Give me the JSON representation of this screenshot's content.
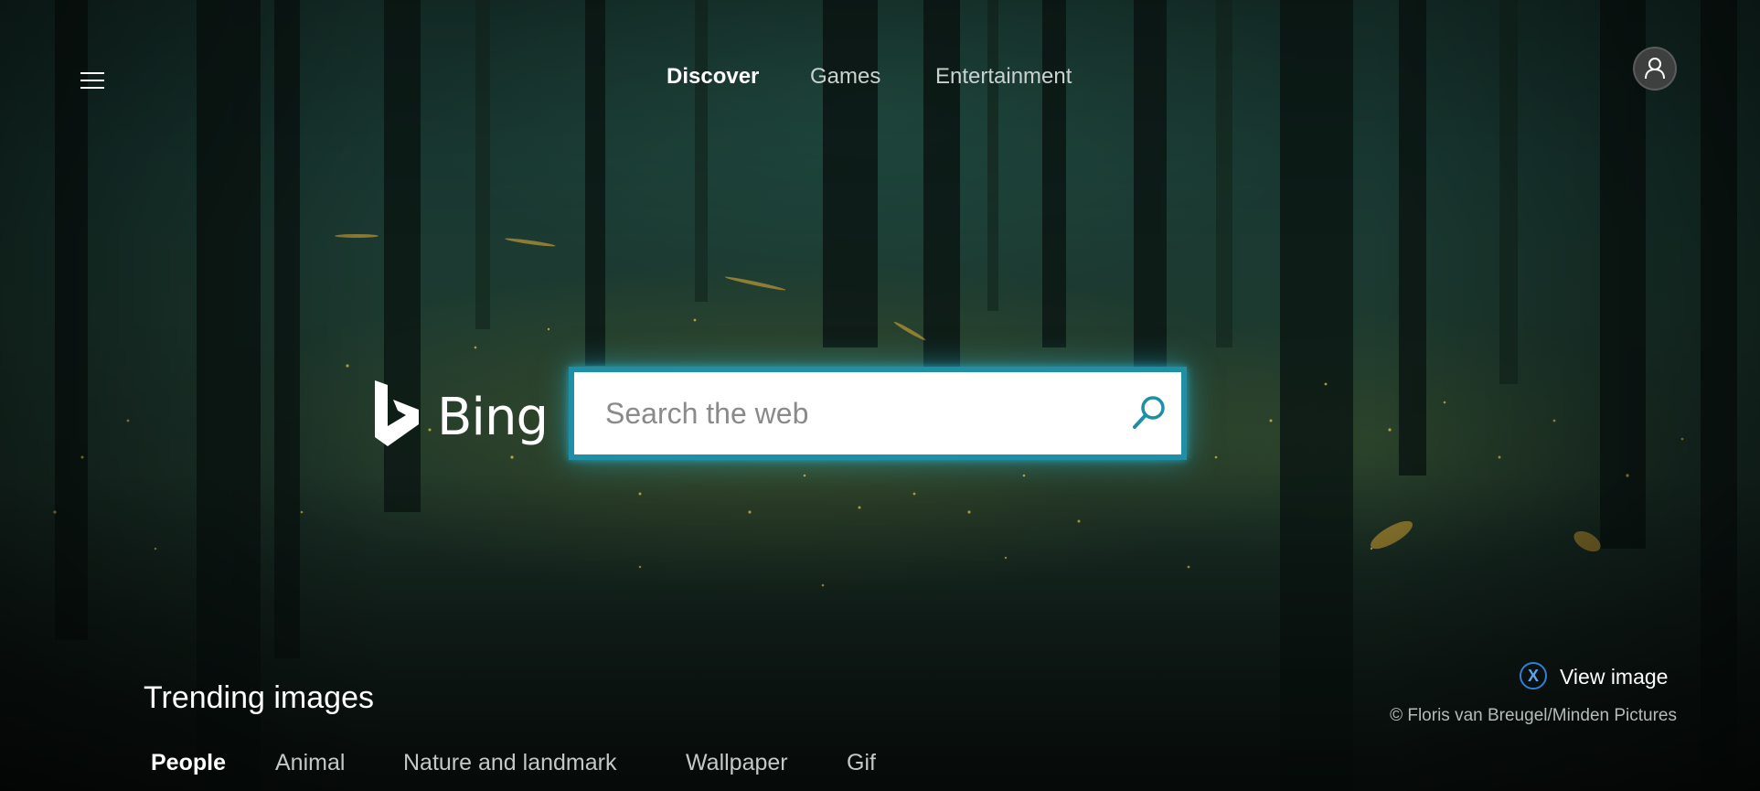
{
  "nav": {
    "menu_icon": "hamburger-menu-icon",
    "tabs": [
      {
        "label": "Discover",
        "active": true
      },
      {
        "label": "Games",
        "active": false
      },
      {
        "label": "Entertainment",
        "active": false
      }
    ],
    "profile_icon": "user-icon"
  },
  "search": {
    "logo_text": "Bing",
    "placeholder": "Search the web",
    "value": "",
    "button_icon": "search-icon",
    "accent_color": "#1f8fa8"
  },
  "background": {
    "view_image_button_glyph": "X",
    "view_image_label": "View image",
    "credit": "© Floris van Breugel/Minden Pictures"
  },
  "trending": {
    "title": "Trending images",
    "categories": [
      {
        "label": "People",
        "active": true
      },
      {
        "label": "Animal",
        "active": false
      },
      {
        "label": "Nature and landmark",
        "active": false
      },
      {
        "label": "Wallpaper",
        "active": false
      },
      {
        "label": "Gif",
        "active": false
      }
    ]
  }
}
